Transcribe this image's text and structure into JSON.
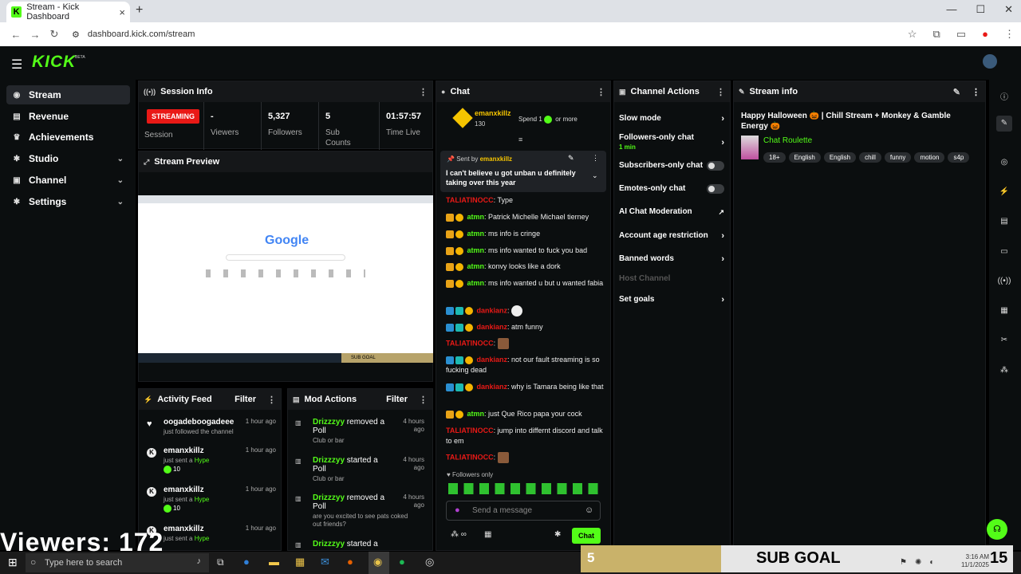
{
  "browser": {
    "tab_title": "Stream - Kick Dashboard",
    "tab_close": "×",
    "new_tab": "+",
    "url": "dashboard.kick.com/stream",
    "window_controls": [
      "—",
      "☐",
      "✕"
    ]
  },
  "header": {
    "logo": "KICK",
    "beta": "BETA"
  },
  "sidebar": {
    "items": [
      {
        "label": "Stream",
        "icon": "broadcast-icon"
      },
      {
        "label": "Revenue",
        "icon": "dollar-icon"
      },
      {
        "label": "Achievements",
        "icon": "trophy-icon"
      },
      {
        "label": "Studio",
        "icon": "gear-icon",
        "chevron": "⌄"
      },
      {
        "label": "Channel",
        "icon": "tv-icon",
        "chevron": "⌄"
      },
      {
        "label": "Settings",
        "icon": "settings-icon",
        "chevron": "⌄"
      }
    ]
  },
  "session": {
    "title": "Session Info",
    "status": "STREAMING",
    "session_label": "Session",
    "stats": [
      {
        "value": "-",
        "label": "Viewers"
      },
      {
        "value": "5,327",
        "label": "Followers"
      },
      {
        "value": "5",
        "label": "Sub Counts"
      },
      {
        "value": "01:57:57",
        "label": "Time Live"
      }
    ]
  },
  "preview": {
    "title": "Stream Preview",
    "google": "Google",
    "sub_goal": "SUB GOAL"
  },
  "chat": {
    "title": "Chat",
    "top_user": "emanxkillz",
    "top_amount": "130",
    "spend_text": "Spend 1",
    "or_more": "or more",
    "pinned_by": "Sent by",
    "pinned_user": "emanxkillz",
    "pinned_msg": "I can't believe u got unban u definitely taking over this year",
    "messages": [
      {
        "user": "TALIATINOCC",
        "text": "Type",
        "color": "red"
      },
      {
        "user": "atmn",
        "text": "Patrick Michelle Michael tierney",
        "color": "green"
      },
      {
        "user": "atmn",
        "text": "ms info is cringe",
        "color": "green"
      },
      {
        "user": "atmn",
        "text": "ms info wanted to fuck you bad",
        "color": "green"
      },
      {
        "user": "atmn",
        "text": "konvy looks like a dork",
        "color": "green"
      },
      {
        "user": "atmn",
        "text": "ms info wanted u but u wanted fabia",
        "color": "green"
      },
      {
        "user": "dankianz",
        "text": "",
        "color": "red"
      },
      {
        "user": "dankianz",
        "text": "atm funny",
        "color": "red"
      },
      {
        "user": "TALIATINOCC",
        "text": "",
        "color": "red"
      },
      {
        "user": "dankianz",
        "text": "not our fault streaming is so fucking dead",
        "color": "red"
      },
      {
        "user": "dankianz",
        "text": "why is Tamara being like that",
        "color": "red"
      },
      {
        "user": "atmn",
        "text": "just Que Rico papa your cock",
        "color": "green"
      },
      {
        "user": "TALIATINOCC",
        "text": "jump into differnt discord and talk to em",
        "color": "red"
      },
      {
        "user": "TALIATINOCC",
        "text": "",
        "color": "red"
      }
    ],
    "followers_only": "Followers only",
    "input_placeholder": "Send a message",
    "send_label": "Chat"
  },
  "channel_actions": {
    "title": "Channel Actions",
    "items": [
      {
        "label": "Slow mode",
        "type": "arrow"
      },
      {
        "label": "Followers-only chat",
        "sub": "1 min",
        "type": "arrow"
      },
      {
        "label": "Subscribers-only chat",
        "type": "toggle"
      },
      {
        "label": "Emotes-only chat",
        "type": "toggle"
      },
      {
        "label": "AI Chat Moderation",
        "type": "external"
      },
      {
        "label": "Account age restriction",
        "type": "arrow"
      },
      {
        "label": "Banned words",
        "type": "arrow"
      },
      {
        "label": "Host Channel",
        "type": "disabled"
      },
      {
        "label": "Set goals",
        "type": "arrow"
      }
    ]
  },
  "stream_info": {
    "title": "Stream info",
    "stream_title": "Happy Halloween 🎃 | Chill Stream + Monkey & Gamble Energy 🎃",
    "category": "Chat Roulette",
    "tags": [
      "18+",
      "English",
      "English",
      "chill",
      "funny",
      "motion",
      "s4p"
    ]
  },
  "activity": {
    "title": "Activity Feed",
    "filter": "Filter",
    "items": [
      {
        "name": "oogadeboogadeee",
        "time": "1 hour ago",
        "sub": "just followed the channel"
      },
      {
        "name": "emanxkillz",
        "time": "1 hour ago",
        "sub": "just sent a",
        "highlight": "Hype",
        "amount": "10"
      },
      {
        "name": "emanxkillz",
        "time": "1 hour ago",
        "sub": "just sent a",
        "highlight": "Hype",
        "amount": "10"
      },
      {
        "name": "emanxkillz",
        "time": "1 hour ago",
        "sub": "just sent a",
        "highlight": "Hype"
      }
    ]
  },
  "mod_actions": {
    "title": "Mod Actions",
    "filter": "Filter",
    "items": [
      {
        "user": "Drizzzyy",
        "action": "removed a Poll",
        "time": "4 hours ago",
        "sub": "Club or bar"
      },
      {
        "user": "Drizzzyy",
        "action": "started a Poll",
        "time": "4 hours ago",
        "sub": "Club or bar"
      },
      {
        "user": "Drizzzyy",
        "action": "removed a Poll",
        "time": "4 hours ago",
        "sub": "are you excited to see pats coked out friends?"
      },
      {
        "user": "Drizzzyy",
        "action": "started a",
        "time": "",
        "sub": ""
      }
    ]
  },
  "overlay": {
    "viewers": "Viewers: 172",
    "sub_goal_count": "5",
    "sub_goal_label": "SUB GOAL",
    "sub_goal_target": "15"
  },
  "taskbar": {
    "search_placeholder": "Type here to search",
    "time": "3:16 AM",
    "date": "11/1/2025"
  }
}
